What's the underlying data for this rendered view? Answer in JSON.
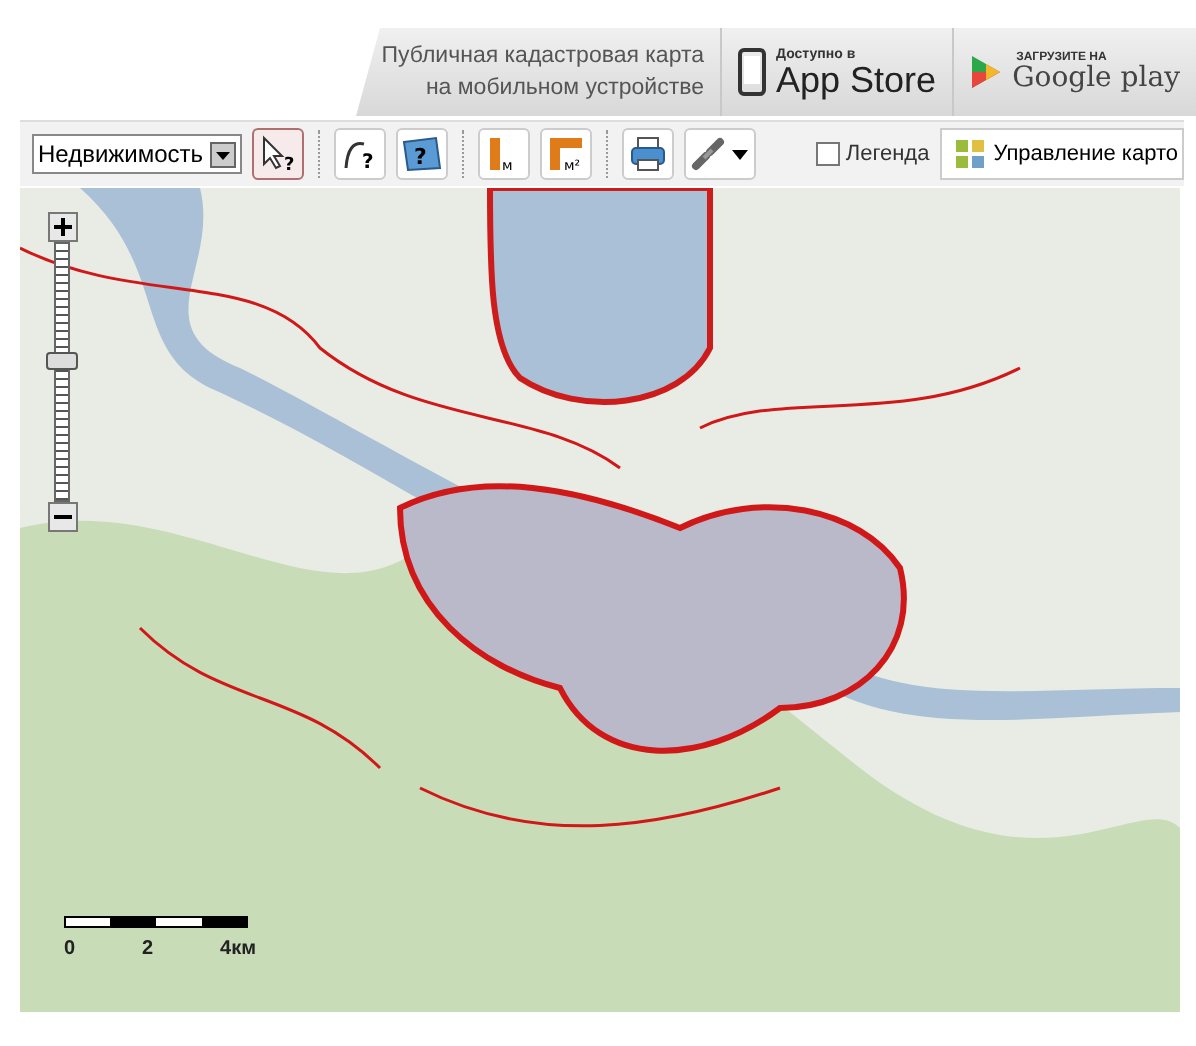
{
  "banner": {
    "text_line1": "Публичная кадастровая карта",
    "text_line2": "на мобильном устройстве",
    "app_store": {
      "small": "Доступно в",
      "big": "App Store"
    },
    "google_play": {
      "small": "ЗАГРУЗИТЕ НА",
      "big": "Google play"
    }
  },
  "toolbar": {
    "layer_select": "Недвижимость",
    "tool_marks": [
      "?",
      "?",
      "?",
      "м",
      "м²"
    ],
    "legend": {
      "label": "Легенда",
      "checked": false
    },
    "manage_button": "Управление карто"
  },
  "map": {
    "zoom": {
      "level": 0.54
    },
    "scale": [
      "0",
      "2",
      "4км"
    ]
  }
}
